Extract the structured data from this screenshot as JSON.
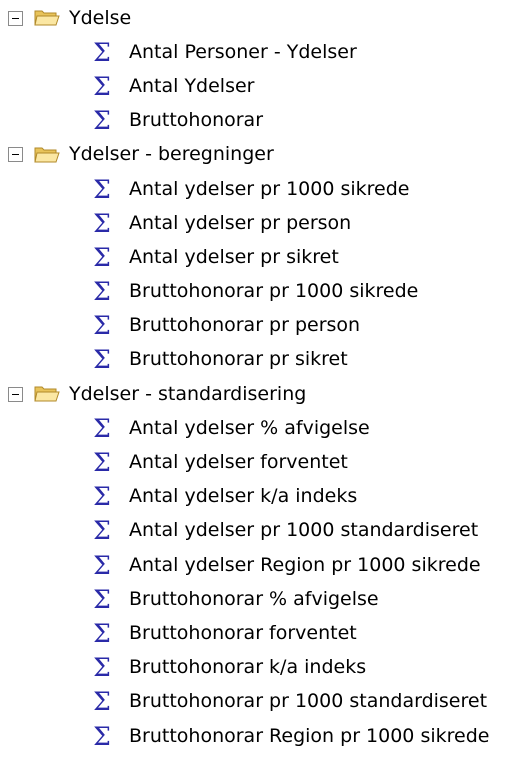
{
  "tree": {
    "folders": [
      {
        "label": "Ydelse",
        "items": [
          "Antal Personer - Ydelser",
          "Antal Ydelser",
          "Bruttohonorar"
        ]
      },
      {
        "label": "Ydelser - beregninger",
        "items": [
          "Antal ydelser pr 1000 sikrede",
          "Antal ydelser pr person",
          "Antal ydelser pr sikret",
          "Bruttohonorar pr 1000 sikrede",
          "Bruttohonorar pr person",
          "Bruttohonorar pr sikret"
        ]
      },
      {
        "label": "Ydelser - standardisering",
        "items": [
          "Antal ydelser % afvigelse",
          "Antal ydelser forventet",
          "Antal ydelser k/a indeks",
          "Antal ydelser pr 1000 standardiseret",
          "Antal ydelser Region pr 1000 sikrede",
          "Bruttohonorar % afvigelse",
          "Bruttohonorar forventet",
          "Bruttohonorar k/a indeks",
          "Bruttohonorar pr 1000 standardiseret",
          "Bruttohonorar Region pr 1000 sikrede"
        ]
      }
    ]
  },
  "icons": {
    "expander": "collapse-minus-icon",
    "folder": "open-folder-icon",
    "measure": "sigma-measure-icon",
    "sigma_color": "#2a2aa8",
    "folder_color": "#f4d77a"
  }
}
